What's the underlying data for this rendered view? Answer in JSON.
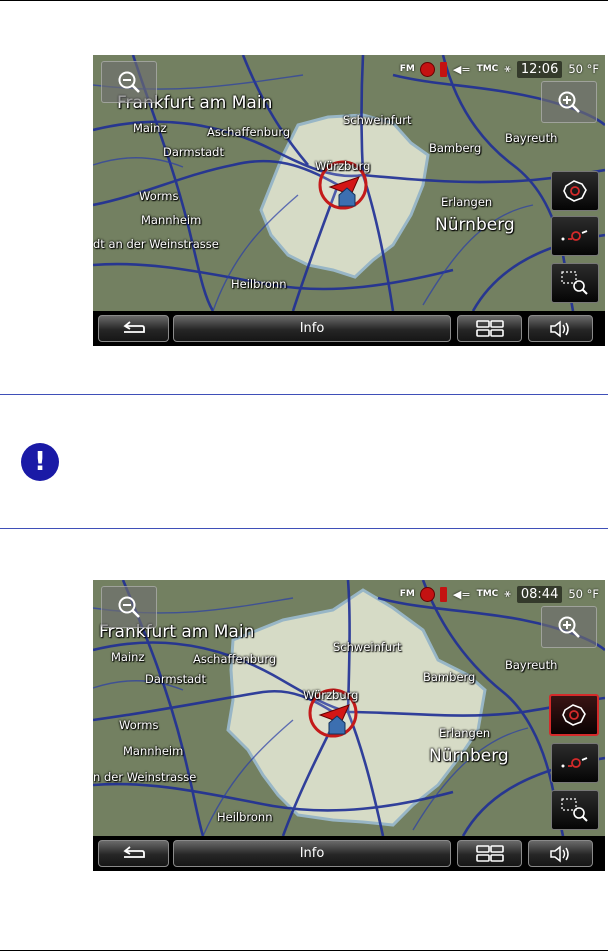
{
  "screens": [
    {
      "status": {
        "fm": "FM",
        "tmc": "TMC",
        "time": "12:06",
        "temperature": "50 °F"
      },
      "labels": {
        "frankfurt": "Frankfurt am Main",
        "mainz": "Mainz",
        "aschaffenburg": "Aschaffenburg",
        "schweinfurt": "Schweinfurt",
        "bayreuth": "Bayreuth",
        "bamberg": "Bamberg",
        "darmstadt": "Darmstadt",
        "wurzburg": "Würzburg",
        "worms": "Worms",
        "erlangen": "Erlangen",
        "nurnberg": "Nürnberg",
        "mannheim": "Mannheim",
        "weinstrasse": "dt an der Weinstrasse",
        "heilbronn": "Heilbronn"
      },
      "selected_side_button": "none",
      "bottom": {
        "info": "Info"
      }
    },
    {
      "status": {
        "fm": "FM",
        "tmc": "TMC",
        "time": "08:44",
        "temperature": "50 °F"
      },
      "labels": {
        "frankfurt": "Frankfurt am Main",
        "mainz": "Mainz",
        "aschaffenburg": "Aschaffenburg",
        "schweinfurt": "Schweinfurt",
        "bayreuth": "Bayreuth",
        "bamberg": "Bamberg",
        "darmstadt": "Darmstadt",
        "wurzburg": "Würzburg",
        "worms": "Worms",
        "erlangen": "Erlangen",
        "nurnberg": "Nürnberg",
        "mannheim": "Mannheim",
        "weinstrasse": "n der Weinstrasse",
        "heilbronn": "Heilbronn"
      },
      "selected_side_button": "region",
      "bottom": {
        "info": "Info"
      }
    }
  ],
  "note": {
    "icon": "exclamation-note-icon",
    "glyph": "!"
  },
  "colors": {
    "accent_blue": "#1a1aa6",
    "separator_blue": "#3f4fb8",
    "map_base": "#6d7a5c",
    "region_fill": "#e8ecd8",
    "road_blue": "#1f2f96",
    "selected_red": "#d42a2a"
  }
}
